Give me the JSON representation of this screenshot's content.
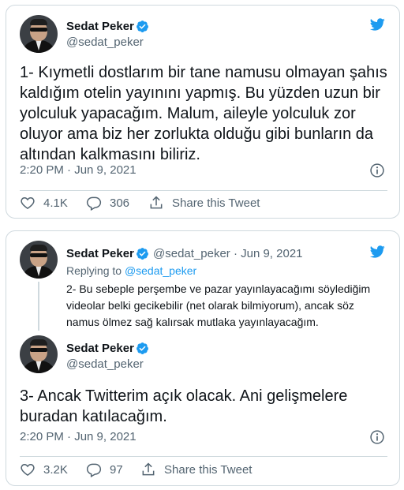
{
  "colors": {
    "accent": "#1d9bf0",
    "text": "#0f1419",
    "muted": "#536471",
    "border": "#cfd9de"
  },
  "tweet1": {
    "author_name": "Sedat Peker",
    "author_handle": "@sedat_peker",
    "lines": [
      "1- Kıymetli dostlarım bir tane namusu olmayan şahıs",
      "kaldığım otelin yayınını yapmış. Bu yüzden uzun bir",
      "yolculuk yapacağım. Malum, aileyle yolculuk zor",
      "oluyor ama biz her zorlukta olduğu gibi bunların da",
      "altından kalkmasını biliriz."
    ],
    "timestamp": "2:20 PM · Jun 9, 2021",
    "likes": "4.1K",
    "replies": "306",
    "share_label": "Share this Tweet"
  },
  "tweet2": {
    "parent": {
      "author_name": "Sedat Peker",
      "author_handle_date": "@sedat_peker · Jun 9, 2021",
      "replying_prefix": "Replying to",
      "replying_to": "@sedat_peker",
      "lines": [
        "2- Bu sebeple perşembe ve pazar yayınlayacağımı söylediğim",
        "videolar belki gecikebilir (net olarak bilmiyorum), ancak söz",
        "namus ölmez sağ kalırsak mutlaka yayınlayacağım."
      ]
    },
    "author_name": "Sedat Peker",
    "author_handle": "@sedat_peker",
    "lines": [
      "3- Ancak Twitterim açık olacak. Ani gelişmelere",
      "buradan katılacağım."
    ],
    "timestamp": "2:20 PM · Jun 9, 2021",
    "likes": "3.2K",
    "replies": "97",
    "share_label": "Share this Tweet"
  }
}
